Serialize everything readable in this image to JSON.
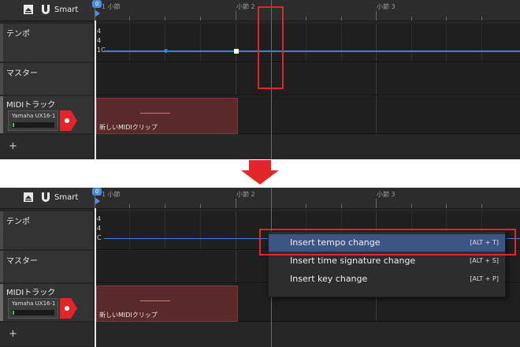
{
  "toolbar": {
    "smart_label": "Smart"
  },
  "ruler": {
    "marker_label": "0",
    "bars": [
      {
        "label": "1 小節"
      },
      {
        "label": "小節 2"
      },
      {
        "label": "小節 3"
      }
    ]
  },
  "tracks": {
    "tempo": {
      "name": "テンポ",
      "values": [
        "4",
        "4",
        "1C"
      ],
      "bottom_values": [
        "4",
        "4",
        "C"
      ]
    },
    "master": {
      "name": "マスター"
    },
    "midi": {
      "name": "MIDIトラック",
      "device": "Yamaha UX16-1",
      "clip_label": "新しいMIDIクリップ"
    }
  },
  "add_track_label": "+",
  "context_menu": {
    "items": [
      {
        "label": "Insert tempo change",
        "shortcut": "[ALT + T]"
      },
      {
        "label": "Insert time signature change",
        "shortcut": "[ALT + S]"
      },
      {
        "label": "Insert key change",
        "shortcut": "[ALT + P]"
      }
    ]
  },
  "colors": {
    "accent": "#4d8fe6",
    "highlight": "#e0262a",
    "record": "#e0262a",
    "clip": "#5a2a2a",
    "menu_selected": "#3c5587"
  }
}
